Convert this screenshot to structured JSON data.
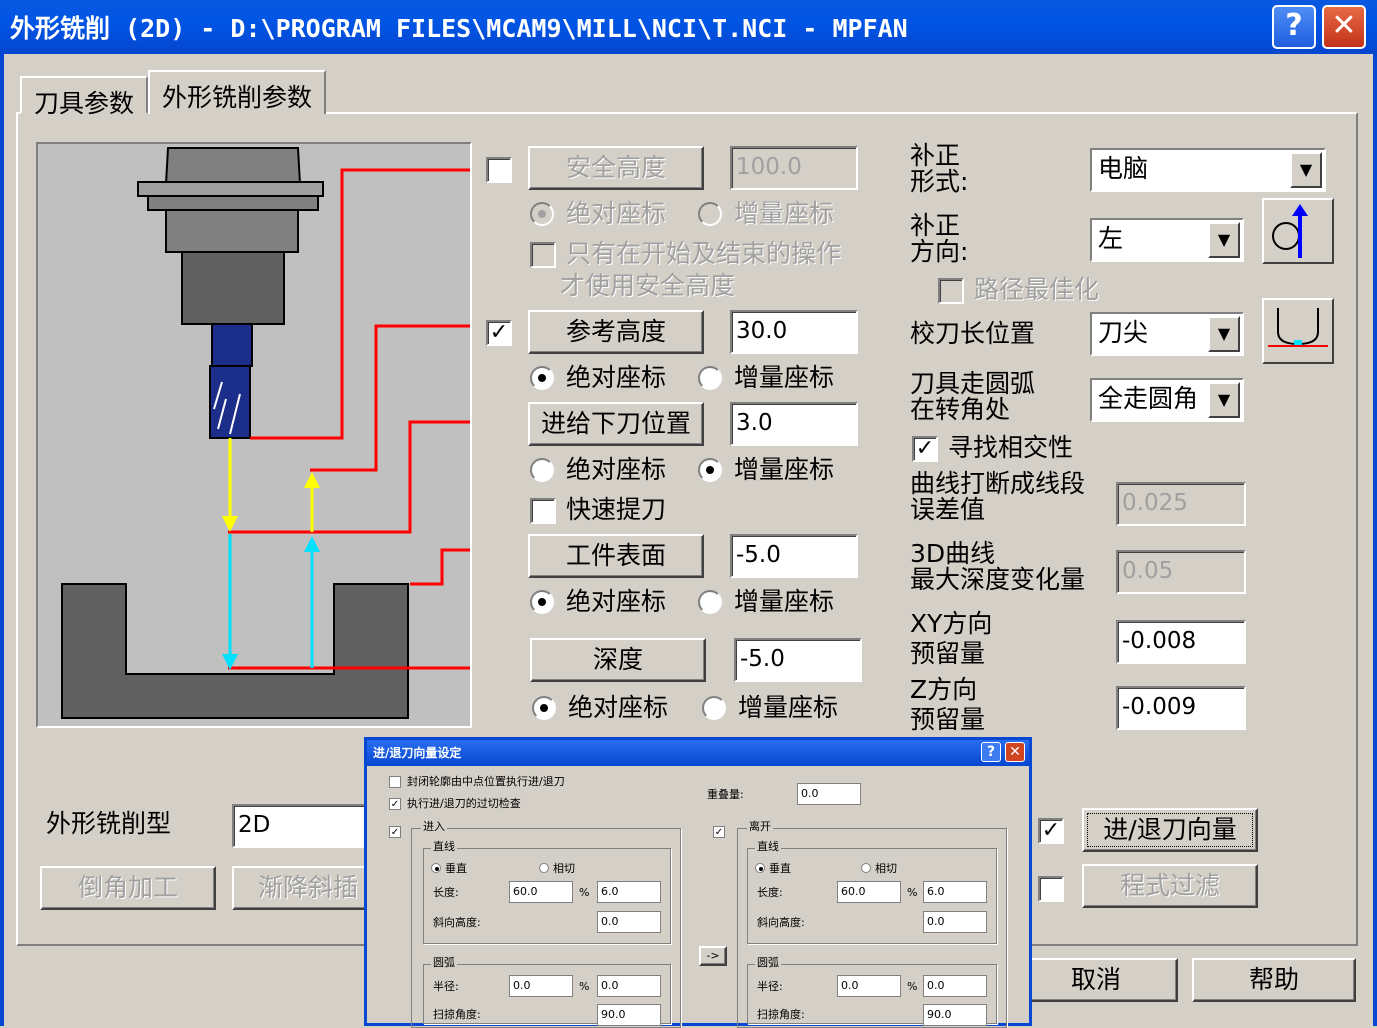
{
  "window": {
    "title": "外形铣削 (2D) - D:\\PROGRAM FILES\\MCAM9\\MILL\\NCI\\T.NCI - MPFAN",
    "help_glyph": "?",
    "close_glyph": "✕"
  },
  "tabs": [
    "刀具参数",
    "外形铣削参数"
  ],
  "heights": {
    "safe": {
      "label": "安全高度",
      "value": "100.0",
      "checked": false,
      "abs_label": "绝对座标",
      "inc_label": "增量座标",
      "only_label_1": "只有在开始及结束的操作",
      "only_label_2": "才使用安全高度"
    },
    "ref": {
      "label": "参考高度",
      "value": "30.0",
      "checked": true,
      "abs_label": "绝对座标",
      "inc_label": "增量座标"
    },
    "feed": {
      "label": "进给下刀位置",
      "value": "3.0",
      "abs_label": "绝对座标",
      "inc_label": "增量座标"
    },
    "rapid_retract": {
      "label": "快速提刀",
      "checked": false
    },
    "top": {
      "label": "工件表面",
      "value": "-5.0",
      "abs_label": "绝对座标",
      "inc_label": "增量座标"
    },
    "depth": {
      "label": "深度",
      "value": "-5.0",
      "abs_label": "绝对座标",
      "inc_label": "增量座标"
    }
  },
  "comp": {
    "type_label_1": "补正",
    "type_label_2": "形式:",
    "type_value": "电脑",
    "dir_label_1": "补正",
    "dir_label_2": "方向:",
    "dir_value": "左",
    "optimize_label": "路径最佳化",
    "tip_label": "校刀长位置",
    "tip_value": "刀尖",
    "arc_label_1": "刀具走圆弧",
    "arc_label_2": "在转角处",
    "arc_value": "全走圆角",
    "intersect_label": "寻找相交性",
    "intersect_checked": true,
    "break_label_1": "曲线打断成线段",
    "break_label_2": "误差值",
    "break_value": "0.025",
    "depth3d_label_1": "3D曲线",
    "depth3d_label_2": "最大深度变化量",
    "depth3d_value": "0.05",
    "xy_label_1": "XY方向",
    "xy_label_2": "预留量",
    "xy_value": "-0.008",
    "z_label_1": "Z方向",
    "z_label_2": "预留量",
    "z_value": "-0.009"
  },
  "bottom": {
    "contour_type_label": "外形铣削型",
    "contour_type_value": "2D",
    "chamfer_label": "倒角加工",
    "ramp_label": "渐降斜插",
    "leadio_label": "进/退刀向量",
    "leadio_checked": true,
    "filter_label": "程式过滤",
    "filter_checked": false,
    "cancel_label": "取消",
    "help_label": "帮助"
  },
  "subdialog": {
    "title": "进/退刀向量设定",
    "closed_mid": "封闭轮廓由中点位置执行进/退刀",
    "gouge_check": "执行进/退刀的过切检查",
    "overlap_label": "重叠量:",
    "overlap_value": "0.0",
    "entry": {
      "label": "进入",
      "line_group": "直线",
      "perp": "垂直",
      "tangent": "相切",
      "length_label": "长度:",
      "length_value": "60.0",
      "pct": "%",
      "pct_value": "6.0",
      "ramp_label": "斜向高度:",
      "ramp_value": "0.0",
      "arc_group": "圆弧",
      "radius_label": "半径:",
      "radius_value": "0.0",
      "rpct_value": "0.0",
      "sweep_label": "扫掠角度:",
      "sweep_value": "90.0"
    },
    "exit": {
      "label": "离开",
      "line_group": "直线",
      "perp": "垂直",
      "tangent": "相切",
      "length_label": "长度:",
      "length_value": "60.0",
      "pct": "%",
      "pct_value": "6.0",
      "ramp_label": "斜向高度:",
      "ramp_value": "0.0",
      "arc_group": "圆弧",
      "radius_label": "半径:",
      "radius_value": "0.0",
      "rpct_value": "0.0",
      "sweep_label": "扫掠角度:",
      "sweep_value": "90.0"
    },
    "copy_label": "->"
  },
  "colors": {
    "titlebar": "#0055e5",
    "face": "#d4d0c8",
    "preview_bg": "#c0c0c0",
    "ref_line": "#ff0000",
    "feed_arrow": "#ffff00",
    "retract_arrow": "#00e0ff",
    "tool": "#1a2e8a"
  }
}
